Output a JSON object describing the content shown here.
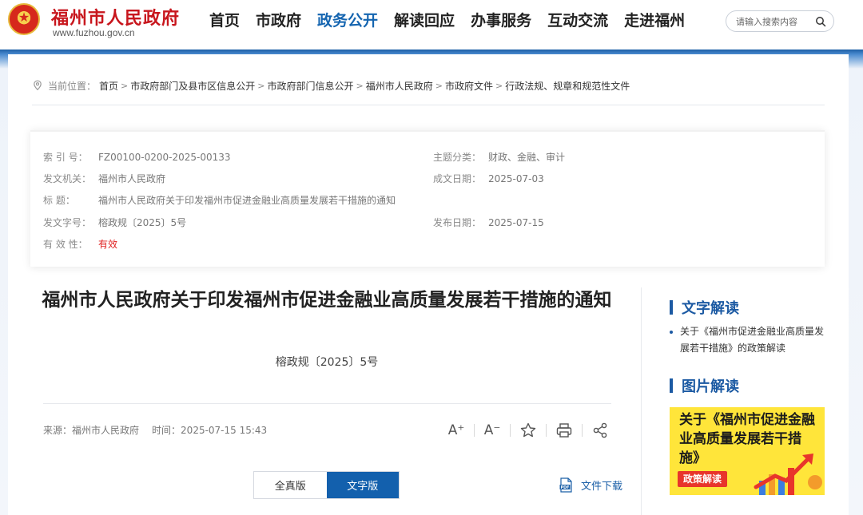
{
  "header": {
    "site_title": "福州市人民政府",
    "site_domain": "www.fuzhou.gov.cn",
    "nav": [
      {
        "label": "首页",
        "active": false
      },
      {
        "label": "市政府",
        "active": false
      },
      {
        "label": "政务公开",
        "active": true
      },
      {
        "label": "解读回应",
        "active": false
      },
      {
        "label": "办事服务",
        "active": false
      },
      {
        "label": "互动交流",
        "active": false
      },
      {
        "label": "走进福州",
        "active": false
      }
    ],
    "search_placeholder": "请输入搜索内容",
    "accent_color": "#1565b0",
    "brand_color": "#c8161d"
  },
  "breadcrumb": {
    "prefix": "当前位置：",
    "items": [
      "首页",
      "市政府部门及县市区信息公开",
      "市政府部门信息公开",
      "福州市人民政府",
      "市政府文件",
      "行政法规、规章和规范性文件"
    ]
  },
  "meta": {
    "index_label": "索 引 号：",
    "index_value": "FZ00100-0200-2025-00133",
    "topic_label": "主题分类：",
    "topic_value": "财政、金融、审计",
    "issuer_label": "发文机关：",
    "issuer_value": "福州市人民政府",
    "written_date_label": "成文日期：",
    "written_date_value": "2025-07-03",
    "title_label": "标 题：",
    "title_value": "福州市人民政府关于印发福州市促进金融业高质量发展若干措施的通知",
    "doc_no_label": "发文字号：",
    "doc_no_value": "榕政规〔2025〕5号",
    "publish_date_label": "发布日期：",
    "publish_date_value": "2025-07-15",
    "validity_label": "有 效 性：",
    "validity_value": "有效"
  },
  "article": {
    "title": "福州市人民政府关于印发福州市促进金融业高质量发展若干措施的通知",
    "doc_number": "榕政规〔2025〕5号",
    "source_label": "来源：",
    "source_value": "福州市人民政府",
    "time_label": "时间：",
    "time_value": "2025-07-15 15:43",
    "tools": [
      "font-increase-icon",
      "font-decrease-icon",
      "star-icon",
      "print-icon",
      "share-icon"
    ],
    "tool_glyphs": {
      "font_increase": "A⁺",
      "font_decrease": "A⁻"
    },
    "toggle": {
      "full_label": "全真版",
      "text_label": "文字版",
      "active": "text"
    },
    "download_label": "文件下载"
  },
  "sidebar": {
    "text_interpretation_title": "文字解读",
    "text_interpretation_link": "关于《福州市促进金融业高质量发展若干措施》的政策解读",
    "image_interpretation_title": "图片解读",
    "poster_text": "关于《福州市促进金融业高质量发展若干措施》",
    "poster_badge": "政策解读"
  }
}
